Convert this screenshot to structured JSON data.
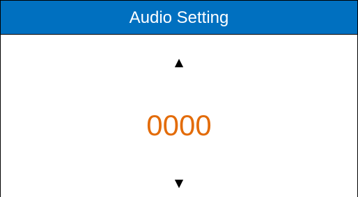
{
  "header": {
    "title": "Audio Setting"
  },
  "controls": {
    "up_glyph": "▲",
    "up_icon": "triangle-up-icon",
    "down_glyph": "▼",
    "down_icon": "triangle-down-icon"
  },
  "value": {
    "display": "0000"
  },
  "colors": {
    "title_bar": "#0070c0",
    "title_text": "#ffffff",
    "value_text": "#e36c0a",
    "arrow": "#000000",
    "background": "#ffffff"
  }
}
